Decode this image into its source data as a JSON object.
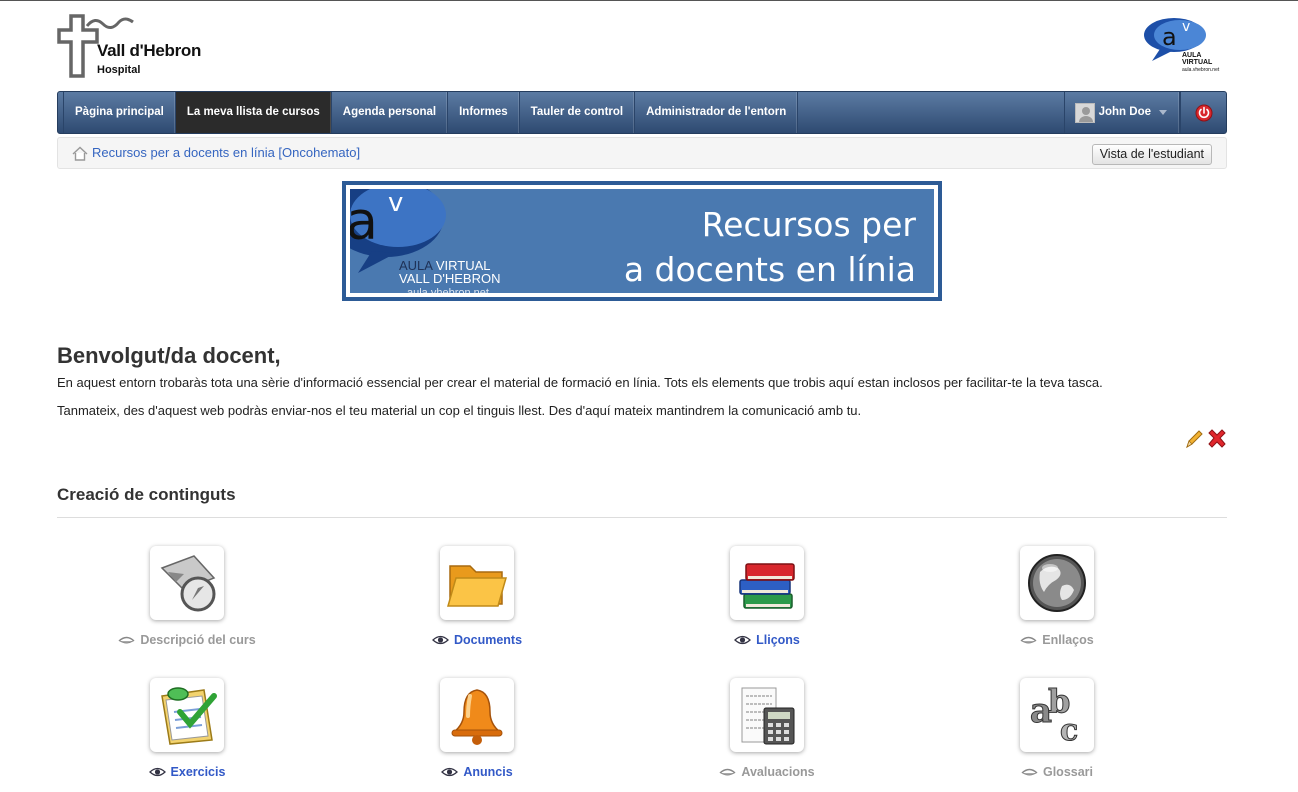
{
  "header": {
    "logo_name": "Vall d'Hebron",
    "logo_sub": "Hospital",
    "right_logo_tag_1": "AULA VIRTUAL",
    "right_logo_tag_2": "aula.vhebron.net"
  },
  "navbar": {
    "items": [
      {
        "label": "Pàgina principal"
      },
      {
        "label": "La meva llista de cursos"
      },
      {
        "label": "Agenda personal"
      },
      {
        "label": "Informes"
      },
      {
        "label": "Tauler de control"
      },
      {
        "label": "Administrador de l'entorn"
      }
    ],
    "active_index": 1,
    "user_name": "John Doe"
  },
  "breadcrumb": {
    "course": "Recursos per a docents en línia [Oncohemato]",
    "student_view_button": "Vista de l'estudiant"
  },
  "banner": {
    "title_line1": "Recursos per",
    "title_line2": "a docents en línia",
    "aula_word1": "AULA",
    "aula_word2": "VIRTUAL",
    "aula_vh": "VALL D'HEBRON",
    "aula_url": "aula.vhebron.net"
  },
  "intro": {
    "heading": "Benvolgut/da docent,",
    "paragraph1": "En aquest entorn trobaràs tota una sèrie d'informació essencial per crear el material de formació en línia. Tots els elements que trobis aquí estan inclosos per facilitar-te la teva tasca.",
    "paragraph2": "Tanmateix, des d'aquest web podràs enviar-nos el teu material un cop el tinguis llest. Des d'aquí mateix mantindrem la comunicació amb tu."
  },
  "section": {
    "title": "Creació de continguts",
    "tools": [
      {
        "label": "Descripció del curs",
        "icon": "compass-icon",
        "visible": false
      },
      {
        "label": "Documents",
        "icon": "folder-icon",
        "visible": true
      },
      {
        "label": "Lliçons",
        "icon": "books-icon",
        "visible": true
      },
      {
        "label": "Enllaços",
        "icon": "globe-icon",
        "visible": false
      },
      {
        "label": "Exercicis",
        "icon": "checklist-icon",
        "visible": true
      },
      {
        "label": "Anuncis",
        "icon": "bell-icon",
        "visible": true
      },
      {
        "label": "Avaluacions",
        "icon": "calculator-icon",
        "visible": false
      },
      {
        "label": "Glossari",
        "icon": "abc-icon",
        "visible": false
      }
    ]
  },
  "colors": {
    "nav_top": "#5c7ba3",
    "nav_bottom": "#2e4a71",
    "link_blue": "#3259c7",
    "banner_blue": "#4a79b0"
  }
}
